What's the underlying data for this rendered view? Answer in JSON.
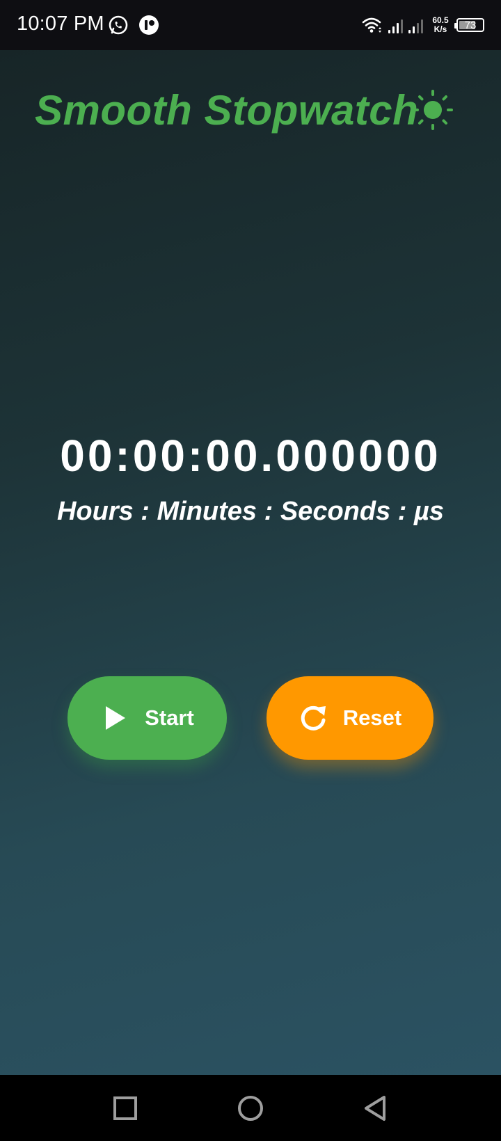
{
  "status_bar": {
    "time": "10:07 PM",
    "notification_icons": [
      "whatsapp-icon",
      "notification-app-icon"
    ],
    "net_speed_value": "60.5",
    "net_speed_unit": "K/s",
    "battery_level": "73",
    "battery_fraction": 0.73
  },
  "app": {
    "title": "Smooth Stopwatch",
    "theme_icon": "sun-icon",
    "timer": {
      "display": "00:00:00.000000",
      "caption": "Hours : Minutes : Seconds : µs"
    },
    "buttons": {
      "start_label": "Start",
      "start_icon": "play-icon",
      "reset_label": "Reset",
      "reset_icon": "refresh-icon"
    }
  },
  "nav_bar": {
    "buttons": [
      "recents-square-icon",
      "home-circle-icon",
      "back-triangle-icon"
    ]
  },
  "colors": {
    "accent_green": "#4caf50",
    "accent_orange": "#ff9800",
    "text": "#ffffff",
    "background_top": "#172527",
    "background_bottom": "#2b5262"
  }
}
